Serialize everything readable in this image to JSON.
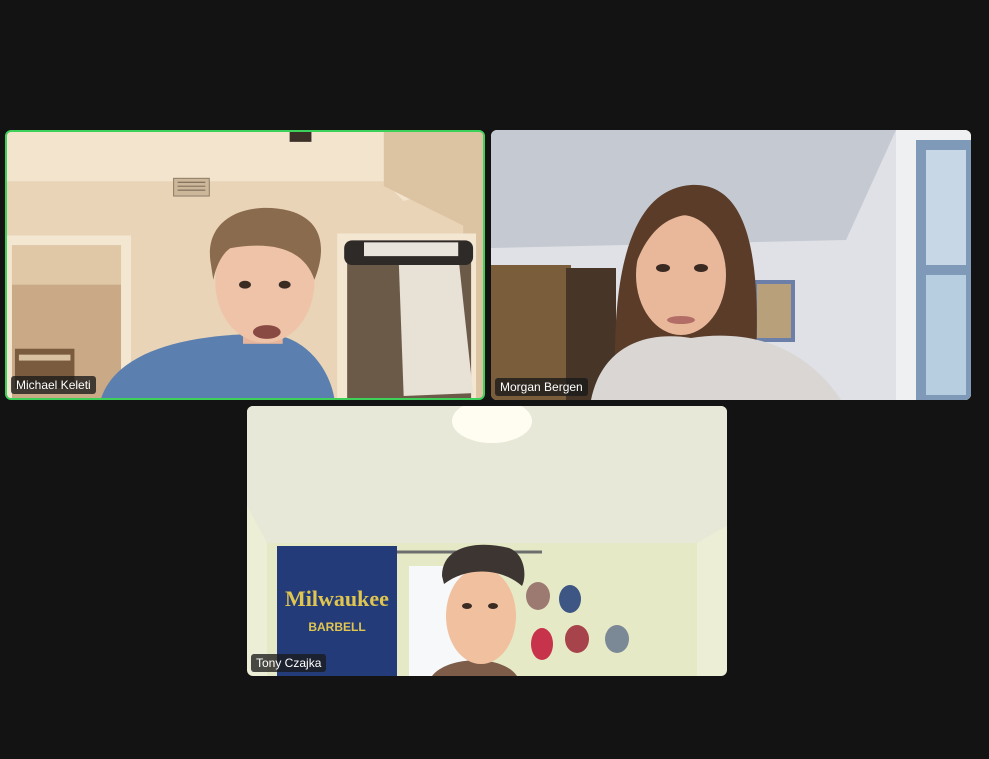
{
  "participants": [
    {
      "name": "Michael Keleti",
      "active_speaker": true
    },
    {
      "name": "Morgan Bergen",
      "active_speaker": false
    },
    {
      "name": "Tony Czajka",
      "active_speaker": false
    }
  ],
  "colors": {
    "background": "#131313",
    "active_speaker_border": "#3ed15a",
    "name_label_bg": "#191919",
    "name_label_text": "#ffffff"
  },
  "banner": {
    "text_line1": "Milwaukee",
    "text_line2": "BARBELL"
  }
}
